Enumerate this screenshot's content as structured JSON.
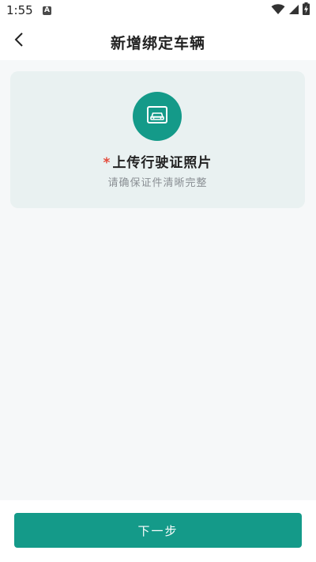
{
  "status_bar": {
    "time": "1:55",
    "badge_letter": "A",
    "icons": [
      "wifi-icon",
      "signal-icon",
      "battery-charging-icon"
    ]
  },
  "header": {
    "back_icon": "chevron-left-icon",
    "title": "新增绑定车辆"
  },
  "upload_card": {
    "icon": "car-license-icon",
    "required_mark": "*",
    "title": "上传行驶证照片",
    "subtitle": "请确保证件清晰完整"
  },
  "footer": {
    "next_label": "下一步"
  },
  "colors": {
    "accent": "#149a89",
    "card_background": "#e9f1f1",
    "page_background": "#f6f8f9",
    "required": "#e44b3b"
  }
}
